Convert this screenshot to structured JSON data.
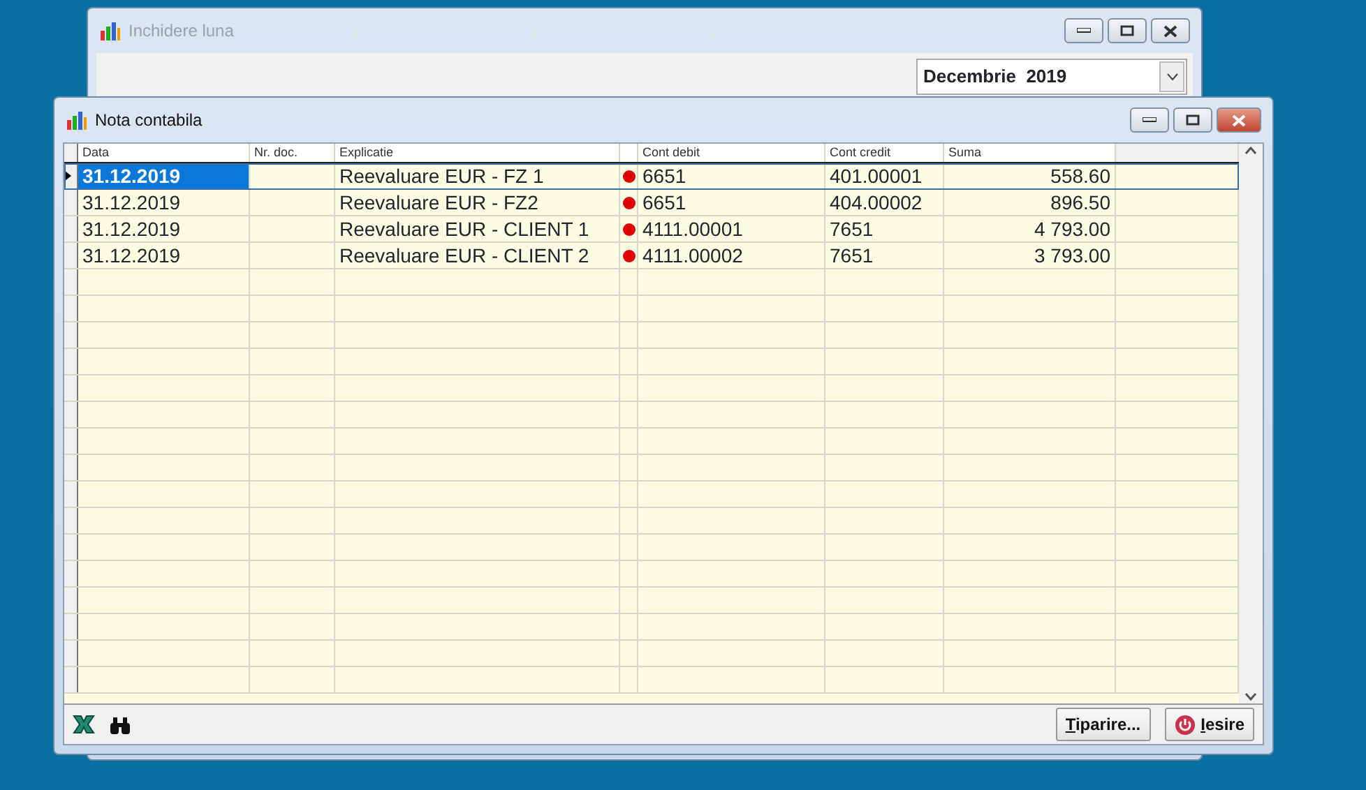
{
  "back_window": {
    "title": "Inchidere luna",
    "period": "Decembrie  2019"
  },
  "window": {
    "title": "Nota contabila"
  },
  "table": {
    "columns": [
      "Data",
      "Nr. doc.",
      "Explicatie",
      "Cont debit",
      "Cont credit",
      "Suma"
    ],
    "rows": [
      {
        "date": "31.12.2019",
        "explanation": "Reevaluare EUR - FZ 1",
        "marked": true,
        "debit": "6651",
        "credit": "401.00001",
        "amount": "558.60",
        "selected": true
      },
      {
        "date": "31.12.2019",
        "explanation": "Reevaluare EUR - FZ2",
        "marked": true,
        "debit": "6651",
        "credit": "404.00002",
        "amount": "896.50",
        "selected": false
      },
      {
        "date": "31.12.2019",
        "explanation": "Reevaluare EUR - CLIENT 1",
        "marked": true,
        "debit": "4111.00001",
        "credit": "7651",
        "amount": "4 793.00",
        "selected": false
      },
      {
        "date": "31.12.2019",
        "explanation": "Reevaluare EUR - CLIENT 2",
        "marked": true,
        "debit": "4111.00002",
        "credit": "7651",
        "amount": "3 793.00",
        "selected": false
      }
    ]
  },
  "buttons": [
    "Tiparire...",
    "Iesire"
  ]
}
